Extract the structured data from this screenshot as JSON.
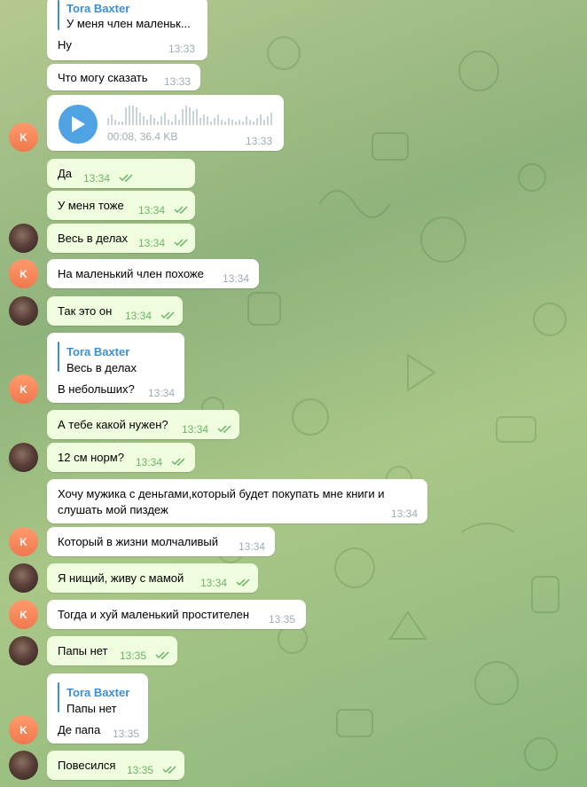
{
  "chat": {
    "colors": {
      "incoming": "#ffffff",
      "outgoing": "#effdde",
      "accent": "#3a8fd6",
      "read_check": "#6cb46a",
      "avatar_k": "#f5845b"
    },
    "avatar_letter": "K",
    "messages": [
      {
        "id": 0,
        "dir": "in",
        "reply_author": "Tora Baxter",
        "reply_text": "У меня член маленьк...",
        "text": "Ну",
        "time": "13:33"
      },
      {
        "id": 1,
        "dir": "in",
        "text": "Что могу сказать",
        "time": "13:33"
      },
      {
        "id": 2,
        "dir": "in",
        "type": "voice",
        "voice_meta": "00:08, 36.4 KB",
        "time": "13:33",
        "avatar": "K"
      },
      {
        "id": 3,
        "dir": "out",
        "text": "Да",
        "time": "13:34",
        "status": "read"
      },
      {
        "id": 4,
        "dir": "out",
        "text": "У меня тоже",
        "time": "13:34",
        "status": "read"
      },
      {
        "id": 5,
        "dir": "out",
        "text": "Весь в делах",
        "time": "13:34",
        "status": "read",
        "avatar": "photo"
      },
      {
        "id": 6,
        "dir": "in",
        "text": "На маленький член похоже",
        "time": "13:34",
        "avatar": "K"
      },
      {
        "id": 7,
        "dir": "out",
        "text": "Так это он",
        "time": "13:34",
        "status": "read",
        "avatar": "photo"
      },
      {
        "id": 8,
        "dir": "in",
        "reply_author": "Tora Baxter",
        "reply_text": "Весь в делах",
        "text": "В небольших?",
        "time": "13:34",
        "avatar": "K"
      },
      {
        "id": 9,
        "dir": "out",
        "text": "А тебе какой нужен?",
        "time": "13:34",
        "status": "read"
      },
      {
        "id": 10,
        "dir": "out",
        "text": "12 см норм?",
        "time": "13:34",
        "status": "read",
        "avatar": "photo"
      },
      {
        "id": 11,
        "dir": "in",
        "text_lines": [
          "Хочу мужика с деньгами,который будет покупать мне книги и",
          "слушать мой пиздеж"
        ],
        "time": "13:34"
      },
      {
        "id": 12,
        "dir": "in",
        "text": "Который в жизни молчаливый",
        "time": "13:34",
        "avatar": "K"
      },
      {
        "id": 13,
        "dir": "out",
        "text": "Я нищий, живу с мамой",
        "time": "13:34",
        "status": "read",
        "avatar": "photo"
      },
      {
        "id": 14,
        "dir": "in",
        "text": "Тогда и хуй маленький простителен",
        "time": "13:35",
        "avatar": "K"
      },
      {
        "id": 15,
        "dir": "out",
        "text": "Папы нет",
        "time": "13:35",
        "status": "read",
        "avatar": "photo"
      },
      {
        "id": 16,
        "dir": "in",
        "reply_author": "Tora Baxter",
        "reply_text": "Папы нет",
        "text": "Де папа",
        "time": "13:35",
        "avatar": "K"
      },
      {
        "id": 17,
        "dir": "out",
        "text": "Повесился",
        "time": "13:35",
        "status": "read",
        "avatar": "photo"
      }
    ]
  }
}
